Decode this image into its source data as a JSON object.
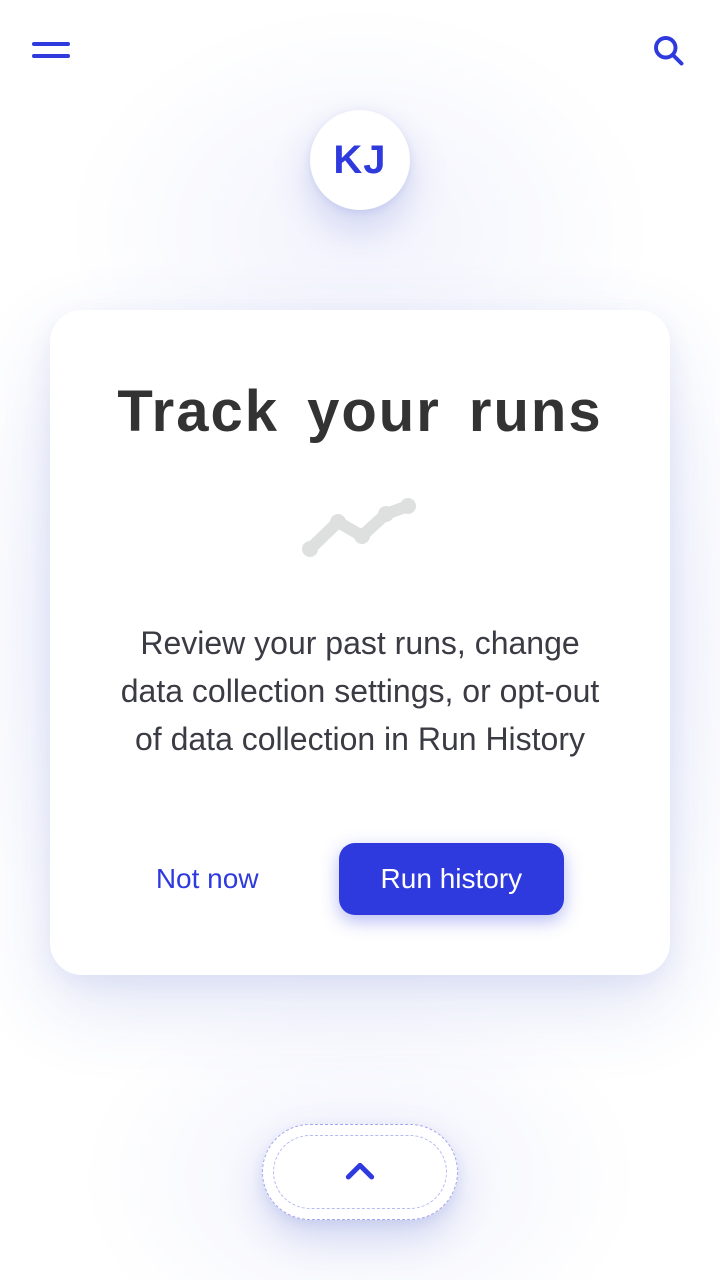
{
  "header": {
    "menu_icon": "hamburger-menu",
    "search_icon": "search"
  },
  "avatar": {
    "initials": "KJ"
  },
  "card": {
    "title": "Track your runs",
    "icon": "timeline",
    "body": "Review your past runs, change data collection settings, or opt-out of data collection in Run History",
    "actions": {
      "dismiss": "Not now",
      "primary": "Run history"
    }
  },
  "bottom": {
    "icon": "chevron-up"
  },
  "theme": {
    "accent": "#2F3ADE"
  }
}
